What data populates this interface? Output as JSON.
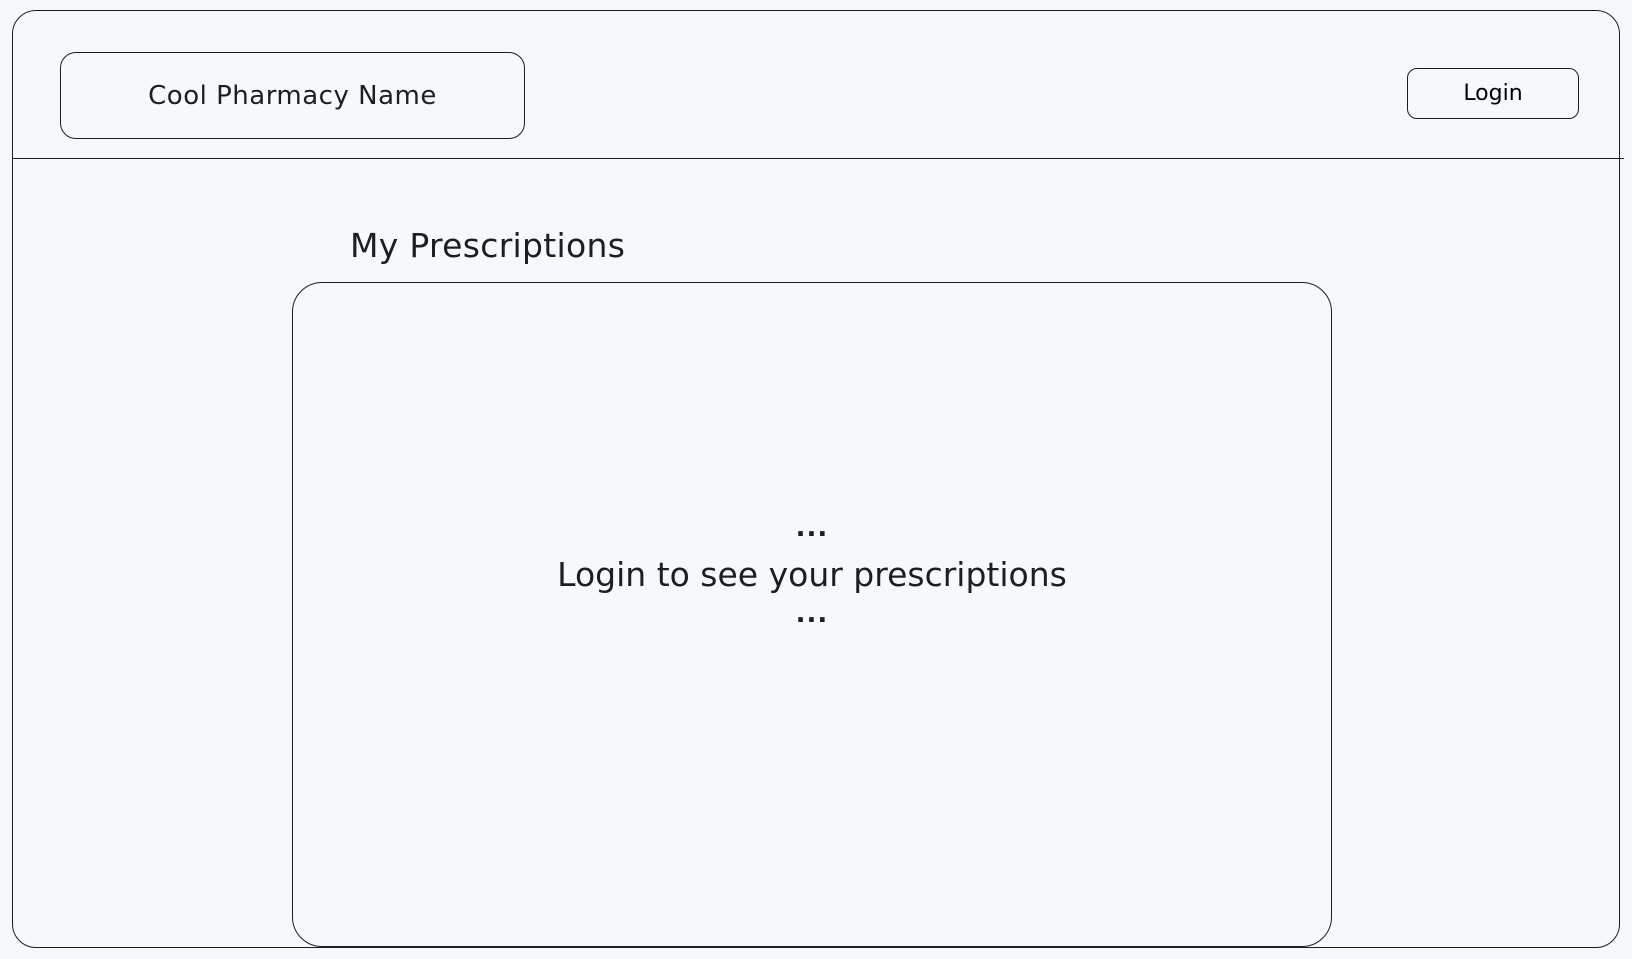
{
  "header": {
    "brand_name": "Cool Pharmacy Name",
    "login_label": "Login"
  },
  "main": {
    "section_title": "My Prescriptions",
    "panel": {
      "ellipsis_top": "...",
      "message": "Login to see your prescriptions",
      "ellipsis_bottom": "..."
    }
  },
  "colors": {
    "background": "#f5f9fc",
    "stroke": "#1e1e1e"
  }
}
